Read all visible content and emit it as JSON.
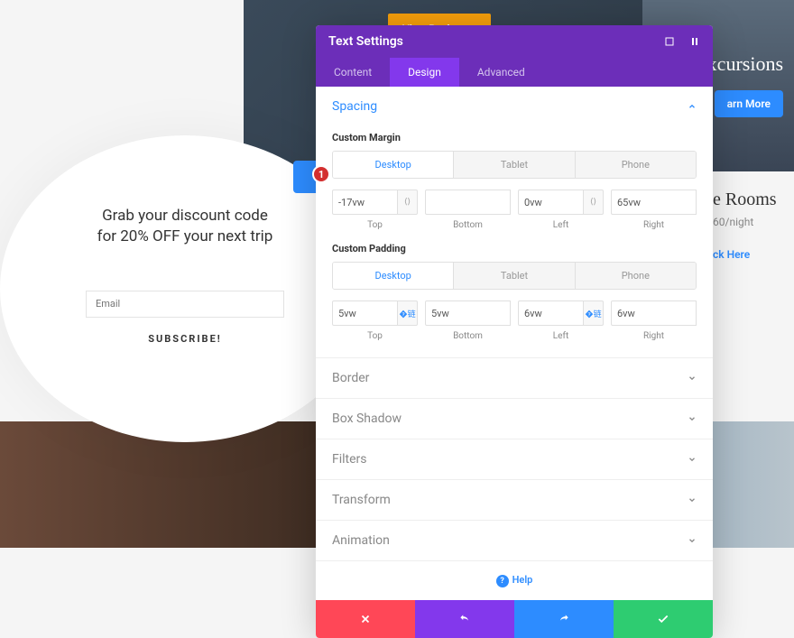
{
  "bg": {
    "hero_btn": "View Packages",
    "right_title": "Excursions",
    "learn_more": "arn More",
    "rooms_title": "e Rooms",
    "rooms_price": "60/night",
    "rooms_link": "ck Here"
  },
  "promo": {
    "line1": "Grab your discount code",
    "line2": "for 20% OFF your next trip",
    "email_placeholder": "Email",
    "subscribe": "SUBSCRIBE!"
  },
  "panel": {
    "title": "Text Settings",
    "tabs": {
      "content": "Content",
      "design": "Design",
      "advanced": "Advanced"
    },
    "spacing": {
      "label": "Spacing",
      "margin_label": "Custom Margin",
      "padding_label": "Custom Padding",
      "devices": {
        "desktop": "Desktop",
        "tablet": "Tablet",
        "phone": "Phone"
      },
      "sides": {
        "top": "Top",
        "bottom": "Bottom",
        "left": "Left",
        "right": "Right"
      },
      "margin": {
        "top": "-17vw",
        "bottom": "",
        "left": "0vw",
        "right": "65vw"
      },
      "padding": {
        "top": "5vw",
        "bottom": "5vw",
        "left": "6vw",
        "right": "6vw"
      }
    },
    "sections": {
      "border": "Border",
      "box_shadow": "Box Shadow",
      "filters": "Filters",
      "transform": "Transform",
      "animation": "Animation"
    },
    "help": "Help"
  },
  "badge": "1"
}
